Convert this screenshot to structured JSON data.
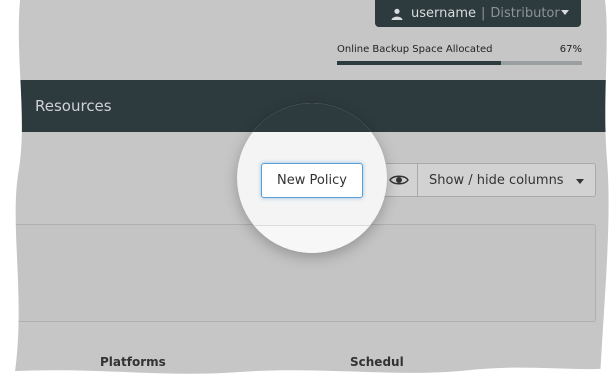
{
  "user_menu": {
    "username": "username",
    "separator": "|",
    "role": "Distributor"
  },
  "backup": {
    "label": "Online Backup Space Allocated",
    "percent_text": "67%",
    "percent": 0.67
  },
  "nav": {
    "partial_item": "s",
    "resources": "Resources"
  },
  "toolbar": {
    "new_policy": "New Policy",
    "show_hide_columns": "Show / hide columns"
  },
  "table": {
    "col_platforms": "Platforms",
    "col_schedule_partial": "Schedul"
  },
  "icons": {
    "user": "user-icon",
    "eye": "eye-icon",
    "caret": "caret-down-icon"
  },
  "colors": {
    "navbar": "#2d3a3e",
    "accent": "#5a9fd6",
    "overlay": "#c6c6c6"
  }
}
